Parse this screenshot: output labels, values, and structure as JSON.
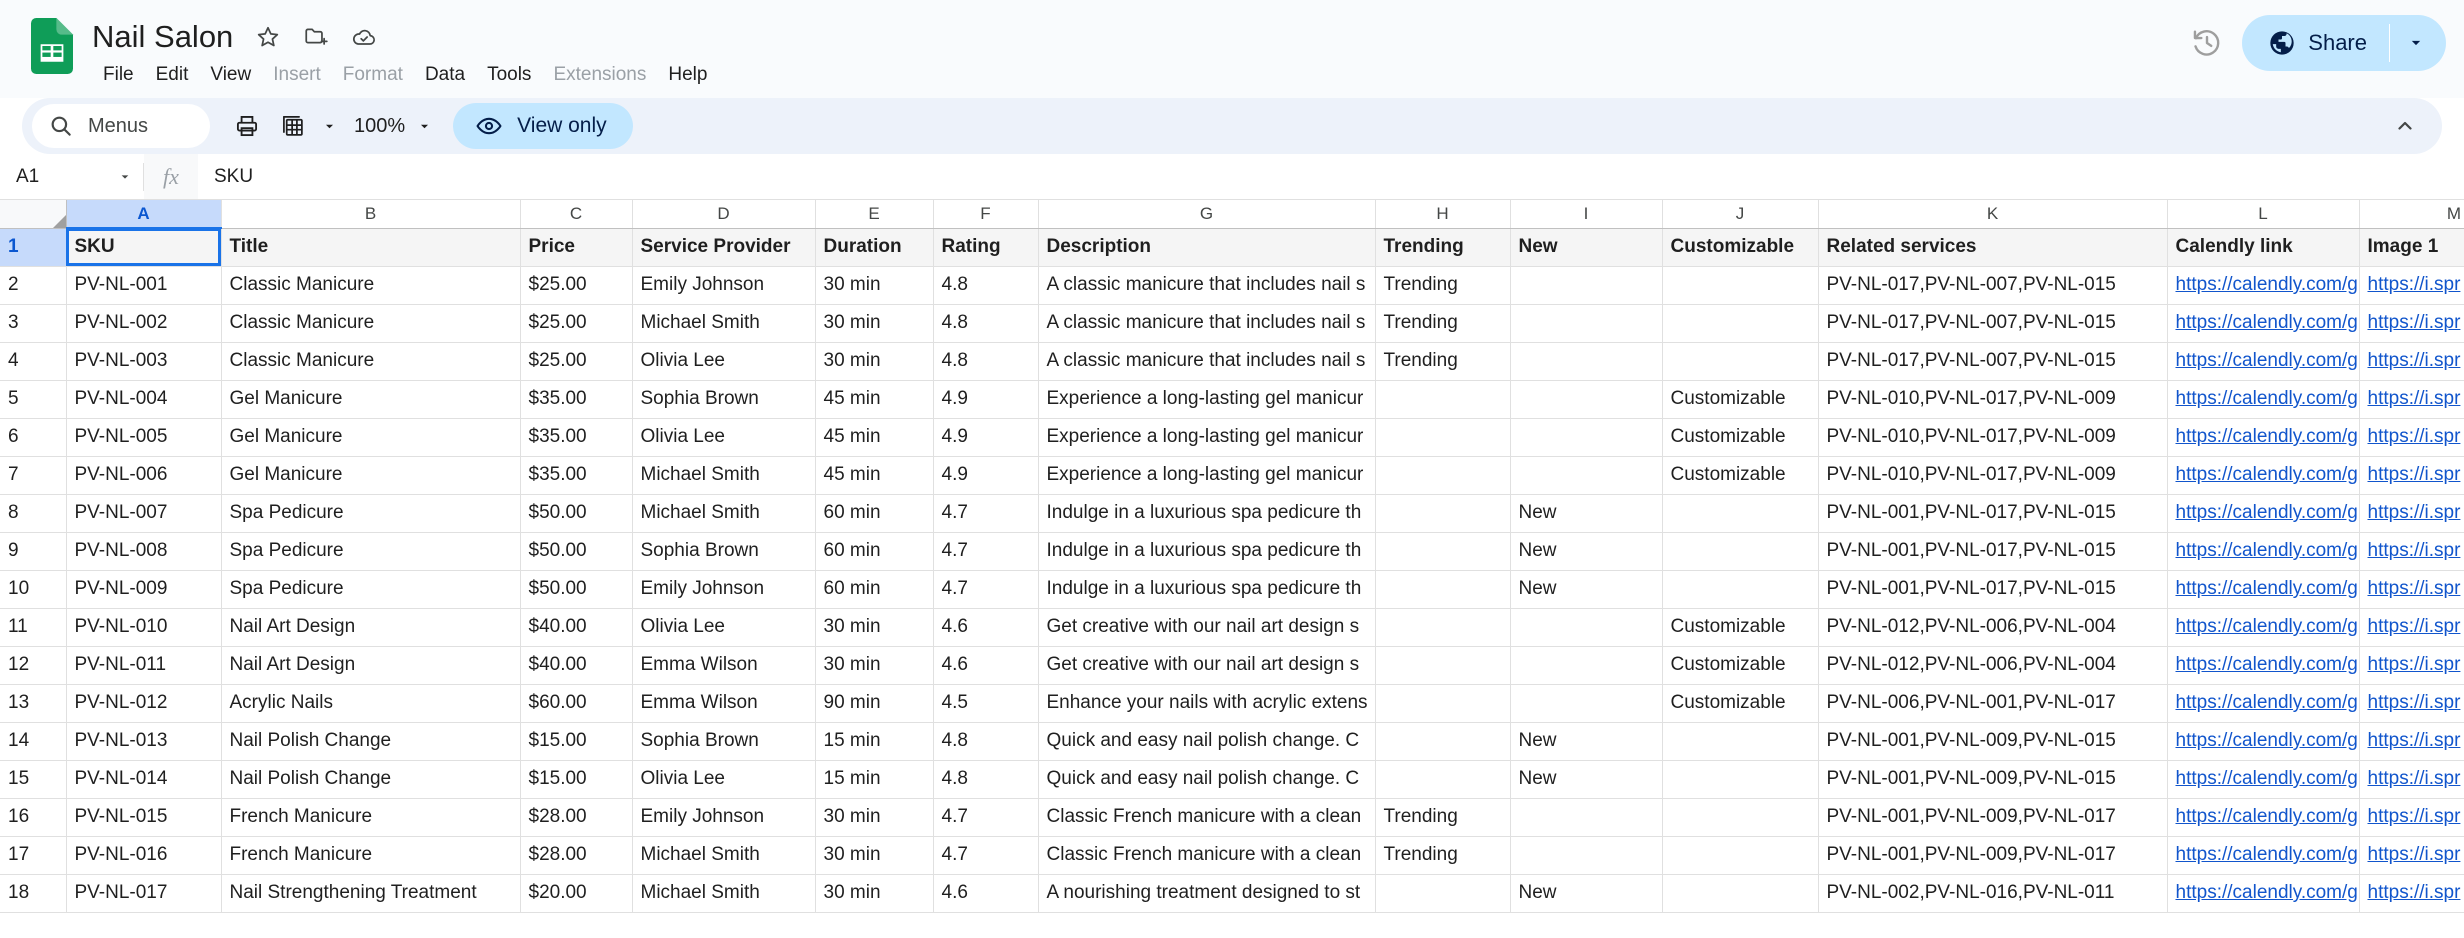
{
  "app": {
    "doc_title": "Nail Salon",
    "logo_icon": "sheets-logo-icon",
    "title_icons": [
      "star-icon",
      "move-to-folder-icon",
      "cloud-saved-icon"
    ],
    "menus": [
      {
        "label": "File",
        "disabled": false
      },
      {
        "label": "Edit",
        "disabled": false
      },
      {
        "label": "View",
        "disabled": false
      },
      {
        "label": "Insert",
        "disabled": true
      },
      {
        "label": "Format",
        "disabled": true
      },
      {
        "label": "Data",
        "disabled": false
      },
      {
        "label": "Tools",
        "disabled": false
      },
      {
        "label": "Extensions",
        "disabled": true
      },
      {
        "label": "Help",
        "disabled": false
      }
    ],
    "history_icon": "version-history-icon",
    "share": {
      "label": "Share",
      "icon": "globe-icon",
      "caret_icon": "chevron-down-icon",
      "bg_color": "#c2e7ff",
      "text_color": "#041e49"
    }
  },
  "toolbar": {
    "search_label": "Menus",
    "search_icon": "search-icon",
    "print_icon": "print-icon",
    "borders_icon": "table-borders-icon",
    "borders_caret_icon": "chevron-down-icon",
    "zoom_value": "100%",
    "zoom_caret_icon": "chevron-down-icon",
    "view_only": {
      "label": "View only",
      "icon": "eye-icon",
      "bg_color": "#c2e7ff",
      "text_color": "#041e49"
    },
    "collapse_icon": "chevron-up-icon"
  },
  "formula_bar": {
    "name_box_value": "A1",
    "name_box_caret_icon": "chevron-down-icon",
    "fx_icon": "fx-icon",
    "formula_value": "SKU"
  },
  "grid": {
    "selected_cell": "A1",
    "column_letters": [
      "A",
      "B",
      "C",
      "D",
      "E",
      "F",
      "G",
      "H",
      "I",
      "J",
      "K",
      "L",
      "M"
    ],
    "row_numbers": [
      1,
      2,
      3,
      4,
      5,
      6,
      7,
      8,
      9,
      10,
      11,
      12,
      13,
      14,
      15,
      16,
      17,
      18
    ],
    "headers": [
      "SKU",
      "Title",
      "Price",
      "Service Provider",
      "Duration",
      "Rating",
      "Description",
      "Trending",
      "New",
      "Customizable",
      "Related services",
      "Calendly link",
      "Image 1"
    ],
    "link_text_calendly": "https://calendly.com/g",
    "link_text_image": "https://i.spr",
    "rows": [
      {
        "sku": "PV-NL-001",
        "title": "Classic Manicure",
        "price": "$25.00",
        "provider": "Emily Johnson",
        "duration": "30 min",
        "rating": "4.8",
        "description": "A classic manicure that includes nail s",
        "trending": "Trending",
        "new": "",
        "customizable": "",
        "related": "PV-NL-017,PV-NL-007,PV-NL-015",
        "calendly": "https://calendly.com/g",
        "image1": "https://i.spr"
      },
      {
        "sku": "PV-NL-002",
        "title": "Classic Manicure",
        "price": "$25.00",
        "provider": "Michael Smith",
        "duration": "30 min",
        "rating": "4.8",
        "description": "A classic manicure that includes nail s",
        "trending": "Trending",
        "new": "",
        "customizable": "",
        "related": "PV-NL-017,PV-NL-007,PV-NL-015",
        "calendly": "https://calendly.com/g",
        "image1": "https://i.spr"
      },
      {
        "sku": "PV-NL-003",
        "title": "Classic Manicure",
        "price": "$25.00",
        "provider": "Olivia Lee",
        "duration": "30 min",
        "rating": "4.8",
        "description": "A classic manicure that includes nail s",
        "trending": "Trending",
        "new": "",
        "customizable": "",
        "related": "PV-NL-017,PV-NL-007,PV-NL-015",
        "calendly": "https://calendly.com/g",
        "image1": "https://i.spr"
      },
      {
        "sku": "PV-NL-004",
        "title": "Gel Manicure",
        "price": "$35.00",
        "provider": "Sophia Brown",
        "duration": "45 min",
        "rating": "4.9",
        "description": "Experience a long-lasting gel manicur",
        "trending": "",
        "new": "",
        "customizable": "Customizable",
        "related": "PV-NL-010,PV-NL-017,PV-NL-009",
        "calendly": "https://calendly.com/g",
        "image1": "https://i.spr"
      },
      {
        "sku": "PV-NL-005",
        "title": "Gel Manicure",
        "price": "$35.00",
        "provider": "Olivia Lee",
        "duration": "45 min",
        "rating": "4.9",
        "description": "Experience a long-lasting gel manicur",
        "trending": "",
        "new": "",
        "customizable": "Customizable",
        "related": "PV-NL-010,PV-NL-017,PV-NL-009",
        "calendly": "https://calendly.com/g",
        "image1": "https://i.spr"
      },
      {
        "sku": "PV-NL-006",
        "title": "Gel Manicure",
        "price": "$35.00",
        "provider": "Michael Smith",
        "duration": "45 min",
        "rating": "4.9",
        "description": "Experience a long-lasting gel manicur",
        "trending": "",
        "new": "",
        "customizable": "Customizable",
        "related": "PV-NL-010,PV-NL-017,PV-NL-009",
        "calendly": "https://calendly.com/g",
        "image1": "https://i.spr"
      },
      {
        "sku": "PV-NL-007",
        "title": "Spa Pedicure",
        "price": "$50.00",
        "provider": "Michael Smith",
        "duration": "60 min",
        "rating": "4.7",
        "description": "Indulge in a luxurious spa pedicure th",
        "trending": "",
        "new": "New",
        "customizable": "",
        "related": "PV-NL-001,PV-NL-017,PV-NL-015",
        "calendly": "https://calendly.com/g",
        "image1": "https://i.spr"
      },
      {
        "sku": "PV-NL-008",
        "title": "Spa Pedicure",
        "price": "$50.00",
        "provider": "Sophia Brown",
        "duration": "60 min",
        "rating": "4.7",
        "description": "Indulge in a luxurious spa pedicure th",
        "trending": "",
        "new": "New",
        "customizable": "",
        "related": "PV-NL-001,PV-NL-017,PV-NL-015",
        "calendly": "https://calendly.com/g",
        "image1": "https://i.spr"
      },
      {
        "sku": "PV-NL-009",
        "title": "Spa Pedicure",
        "price": "$50.00",
        "provider": "Emily Johnson",
        "duration": "60 min",
        "rating": "4.7",
        "description": "Indulge in a luxurious spa pedicure th",
        "trending": "",
        "new": "New",
        "customizable": "",
        "related": "PV-NL-001,PV-NL-017,PV-NL-015",
        "calendly": "https://calendly.com/g",
        "image1": "https://i.spr"
      },
      {
        "sku": "PV-NL-010",
        "title": "Nail Art Design",
        "price": "$40.00",
        "provider": "Olivia Lee",
        "duration": "30 min",
        "rating": "4.6",
        "description": "Get creative with our nail art design s",
        "trending": "",
        "new": "",
        "customizable": "Customizable",
        "related": "PV-NL-012,PV-NL-006,PV-NL-004",
        "calendly": "https://calendly.com/g",
        "image1": "https://i.spr"
      },
      {
        "sku": "PV-NL-011",
        "title": "Nail Art Design",
        "price": "$40.00",
        "provider": "Emma Wilson",
        "duration": "30 min",
        "rating": "4.6",
        "description": "Get creative with our nail art design s",
        "trending": "",
        "new": "",
        "customizable": "Customizable",
        "related": "PV-NL-012,PV-NL-006,PV-NL-004",
        "calendly": "https://calendly.com/g",
        "image1": "https://i.spr"
      },
      {
        "sku": "PV-NL-012",
        "title": "Acrylic Nails",
        "price": "$60.00",
        "provider": "Emma Wilson",
        "duration": "90 min",
        "rating": "4.5",
        "description": "Enhance your nails with acrylic extens",
        "trending": "",
        "new": "",
        "customizable": "Customizable",
        "related": "PV-NL-006,PV-NL-001,PV-NL-017",
        "calendly": "https://calendly.com/g",
        "image1": "https://i.spr"
      },
      {
        "sku": "PV-NL-013",
        "title": "Nail Polish Change",
        "price": "$15.00",
        "provider": "Sophia Brown",
        "duration": "15 min",
        "rating": "4.8",
        "description": "Quick and easy nail polish change. C",
        "trending": "",
        "new": "New",
        "customizable": "",
        "related": "PV-NL-001,PV-NL-009,PV-NL-015",
        "calendly": "https://calendly.com/g",
        "image1": "https://i.spr"
      },
      {
        "sku": "PV-NL-014",
        "title": "Nail Polish Change",
        "price": "$15.00",
        "provider": "Olivia Lee",
        "duration": "15 min",
        "rating": "4.8",
        "description": "Quick and easy nail polish change. C",
        "trending": "",
        "new": "New",
        "customizable": "",
        "related": "PV-NL-001,PV-NL-009,PV-NL-015",
        "calendly": "https://calendly.com/g",
        "image1": "https://i.spr"
      },
      {
        "sku": "PV-NL-015",
        "title": "French Manicure",
        "price": "$28.00",
        "provider": "Emily Johnson",
        "duration": "30 min",
        "rating": "4.7",
        "description": "Classic French manicure with a clean",
        "trending": "Trending",
        "new": "",
        "customizable": "",
        "related": "PV-NL-001,PV-NL-009,PV-NL-017",
        "calendly": "https://calendly.com/g",
        "image1": "https://i.spr"
      },
      {
        "sku": "PV-NL-016",
        "title": "French Manicure",
        "price": "$28.00",
        "provider": "Michael Smith",
        "duration": "30 min",
        "rating": "4.7",
        "description": "Classic French manicure with a clean",
        "trending": "Trending",
        "new": "",
        "customizable": "",
        "related": "PV-NL-001,PV-NL-009,PV-NL-017",
        "calendly": "https://calendly.com/g",
        "image1": "https://i.spr"
      },
      {
        "sku": "PV-NL-017",
        "title": "Nail Strengthening Treatment",
        "price": "$20.00",
        "provider": "Michael Smith",
        "duration": "30 min",
        "rating": "4.6",
        "description": "A nourishing treatment designed to st",
        "trending": "",
        "new": "New",
        "customizable": "",
        "related": "PV-NL-002,PV-NL-016,PV-NL-011",
        "calendly": "https://calendly.com/g",
        "image1": "https://i.spr"
      }
    ]
  }
}
